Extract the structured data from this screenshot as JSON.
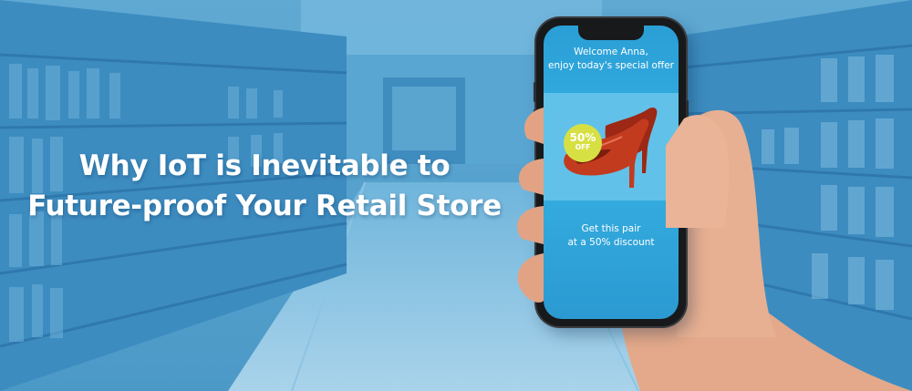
{
  "headline": {
    "line1": "Why IoT is Inevitable to",
    "line2": "Future-proof Your Retail Store"
  },
  "phone_screen": {
    "welcome_line1": "Welcome Anna,",
    "welcome_line2": "enjoy today's special offer",
    "badge_percent": "50%",
    "badge_off": "OFF",
    "cta_line1": "Get this pair",
    "cta_line2": "at a 50% discount"
  },
  "colors": {
    "overlay_blue": "#4a9ccb",
    "screen_blue": "#2a9fd6",
    "badge_yellow": "#d7e043",
    "shoe_red": "#b5321c"
  },
  "icons": {
    "product": "red-high-heel-shoe-icon",
    "hand": "hand-holding-phone"
  }
}
